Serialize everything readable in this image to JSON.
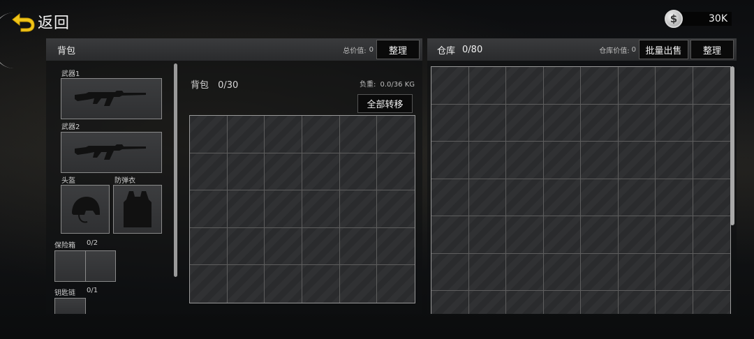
{
  "topbar": {
    "back_label": "返回",
    "currency_amount": "30K",
    "currency_symbol": "$"
  },
  "backpack_panel": {
    "title": "背包",
    "total_value_label": "总价值:",
    "total_value": "0",
    "sort_button": "整理",
    "equipment": {
      "weapon1_label": "武器1",
      "weapon2_label": "武器2",
      "helmet_label": "头盔",
      "armor_label": "防弹衣",
      "safebox_label": "保险箱",
      "safebox_count": "0/2",
      "keychain_label": "钥匙链",
      "keychain_count": "0/1"
    },
    "grid": {
      "title": "背包",
      "count": "0/30",
      "weight_label": "负重:",
      "weight_value": "0.0/36 KG",
      "transfer_all_button": "全部转移",
      "columns": 6,
      "rows": 5
    }
  },
  "warehouse_panel": {
    "title": "仓库",
    "count": "0/80",
    "value_label": "仓库价值:",
    "value": "0",
    "bulk_sell_button": "批量出售",
    "sort_button": "整理",
    "columns": 8,
    "visible_rows": 7
  },
  "icons": [
    "back-arrow-icon",
    "coin-icon",
    "rifle-icon",
    "helmet-icon",
    "vest-icon"
  ]
}
